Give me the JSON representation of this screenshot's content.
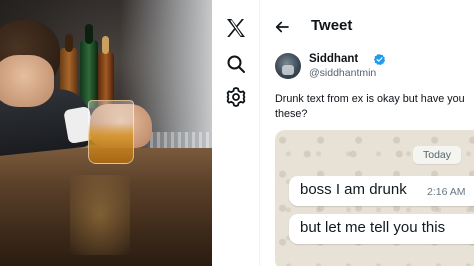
{
  "photo": {
    "alt": "man slumped on a bar counter holding a glass of whiskey"
  },
  "nav": {
    "icons": [
      "x-logo-icon",
      "search-icon",
      "settings-icon"
    ]
  },
  "header": {
    "title": "Tweet"
  },
  "tweet": {
    "author_name": "Siddhant",
    "author_handle": "@siddhantmin",
    "text_line1": "Drunk text from ex is okay but have you",
    "text_line2": "these?"
  },
  "chat": {
    "date_label": "Today",
    "messages": [
      {
        "text": "boss I am drunk",
        "time": "2:16 AM"
      },
      {
        "text": "but let me tell you this",
        "time": ""
      }
    ]
  },
  "colors": {
    "text": "#0f1419",
    "secondary": "#536471",
    "verified": "#1d9bf0",
    "chat_bg": "#e8e1d6"
  }
}
